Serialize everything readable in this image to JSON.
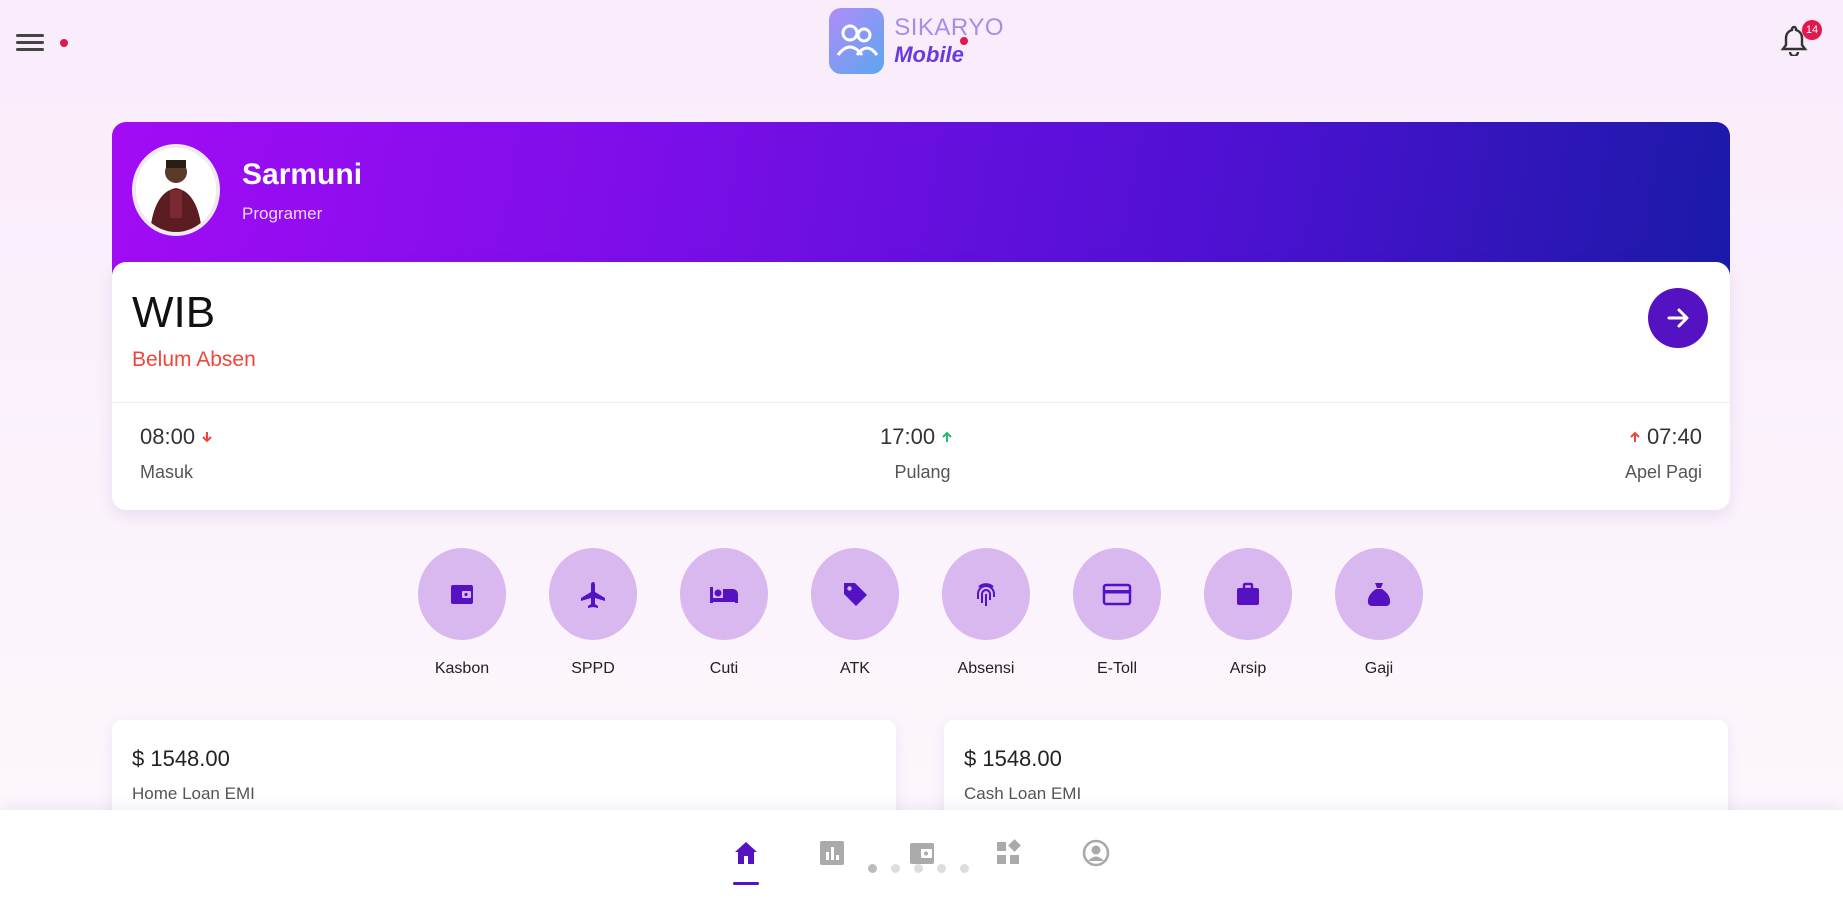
{
  "header": {
    "logo_line1": "SIKARYO",
    "logo_line2": "Mobile",
    "notification_count": "14"
  },
  "profile": {
    "name": "Sarmuni",
    "role": "Programer"
  },
  "attendance": {
    "timezone": "WIB",
    "status": "Belum Absen",
    "slots": [
      {
        "time": "08:00",
        "label": "Masuk"
      },
      {
        "time": "17:00",
        "label": "Pulang"
      },
      {
        "time": "07:40",
        "label": "Apel Pagi"
      }
    ]
  },
  "menu": {
    "items": [
      {
        "label": "Kasbon",
        "icon": "wallet-icon"
      },
      {
        "label": "SPPD",
        "icon": "airplane-icon"
      },
      {
        "label": "Cuti",
        "icon": "bed-icon"
      },
      {
        "label": "ATK",
        "icon": "tag-icon"
      },
      {
        "label": "Absensi",
        "icon": "fingerprint-icon"
      },
      {
        "label": "E-Toll",
        "icon": "card-icon"
      },
      {
        "label": "Arsip",
        "icon": "briefcase-icon"
      },
      {
        "label": "Gaji",
        "icon": "money-bag-icon"
      }
    ]
  },
  "loans": [
    {
      "amount": "$ 1548.00",
      "label": "Home Loan EMI"
    },
    {
      "amount": "$ 1548.00",
      "label": "Cash Loan EMI"
    }
  ],
  "colors": {
    "accent": "#5512c2",
    "menu_circle": "#d8b8ef",
    "status_red": "#f0453a"
  }
}
